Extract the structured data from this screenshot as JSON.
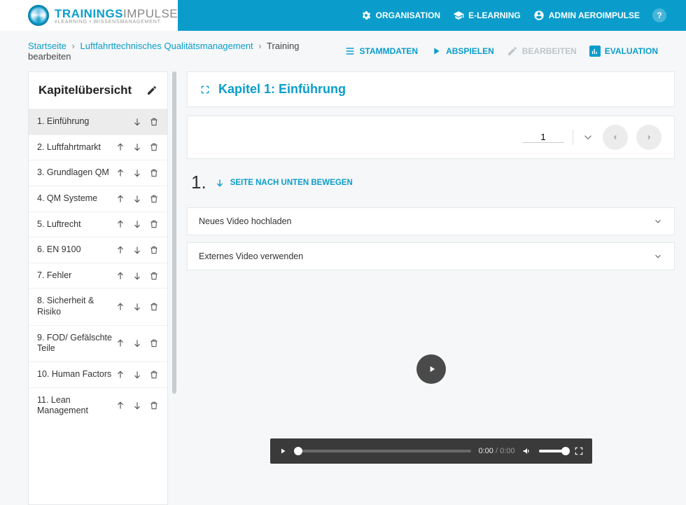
{
  "logo": {
    "brand1": "TRAININGS",
    "brand2": "IMPULSE",
    "tagline": "eLEARNING • WISSENSMANAGEMENT"
  },
  "header": {
    "org": "ORGANISATION",
    "elearning": "E-LEARNING",
    "user": "ADMIN AEROIMPULSE",
    "help": "?"
  },
  "breadcrumb": {
    "home": "Startseite",
    "course": "Luftfahrttechnisches Qualitätsmanagement",
    "current": "Training bearbeiten",
    "sep": "›"
  },
  "tabs": {
    "stammdaten": "STAMMDATEN",
    "abspielen": "ABSPIELEN",
    "bearbeiten": "BEARBEITEN",
    "evaluation": "EVALUATION"
  },
  "sidebar": {
    "title": "Kapitelübersicht",
    "chapters": [
      {
        "label": "1. Einführung",
        "up": false,
        "active": true
      },
      {
        "label": "2. Luftfahrtmarkt",
        "up": true
      },
      {
        "label": "3. Grundlagen QM",
        "up": true
      },
      {
        "label": "4. QM Systeme",
        "up": true
      },
      {
        "label": "5. Luftrecht",
        "up": true
      },
      {
        "label": "6. EN 9100",
        "up": true
      },
      {
        "label": "7. Fehler",
        "up": true
      },
      {
        "label": "8. Sicherheit & Risiko",
        "up": true
      },
      {
        "label": "9. FOD/ Gefälschte Teile",
        "up": true
      },
      {
        "label": "10. Human Factors",
        "up": true
      },
      {
        "label": "11. Lean Management",
        "up": true
      }
    ]
  },
  "content": {
    "chapter_title": "Kapitel 1: Einführung",
    "page_number": "1",
    "section_number": "1.",
    "move_down": "SEITE NACH UNTEN BEWEGEN",
    "acc1": "Neues Video hochladen",
    "acc2": "Externes Video verwenden",
    "video": {
      "current": "0:00",
      "duration": "0:00",
      "sep": " / "
    }
  }
}
